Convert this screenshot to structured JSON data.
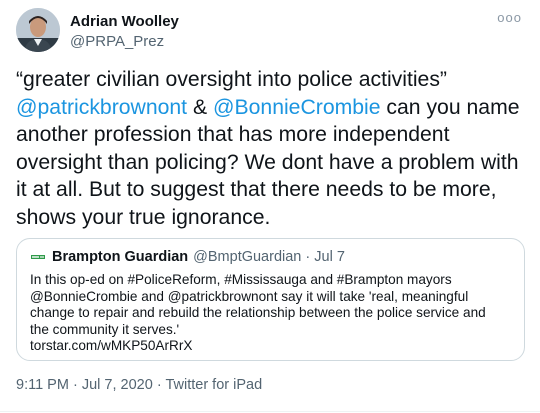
{
  "tweet": {
    "author_name": "Adrian Woolley",
    "author_handle": "@PRPA_Prez",
    "more_icon": "ooo",
    "text_lines": [
      [
        "“greater civilian oversight into police activities”"
      ],
      [
        "@patrickbrownont",
        " & ",
        "@BonnieCrombie",
        " can you name"
      ],
      [
        "another profession that has more independent"
      ],
      [
        "oversight than policing? We dont have a problem with"
      ],
      [
        "it at all. But to suggest that there needs to be more,"
      ],
      [
        "shows your true ignorance."
      ]
    ],
    "time": "9:11 PM",
    "date": "Jul 7, 2020",
    "source": "Twitter for iPad",
    "separator": "·"
  },
  "quote": {
    "name": "Brampton Guardian",
    "handle": "@BmptGuardian",
    "separator": "·",
    "date": "Jul 7",
    "text_lines": [
      "In this op-ed on #PoliceReform, #Mississauga and #Brampton mayors",
      "@BonnieCrombie and @patrickbrownont say it will take 'real, meaningful",
      "change to repair and rebuild the relationship between the police service and",
      "the community it serves.'",
      "torstar.com/wMKP50ArRrX"
    ],
    "icon": "newspaper-logo-icon"
  },
  "colors": {
    "link": "#1b95e0",
    "secondary_text": "#536471",
    "border": "#cfd9de"
  }
}
